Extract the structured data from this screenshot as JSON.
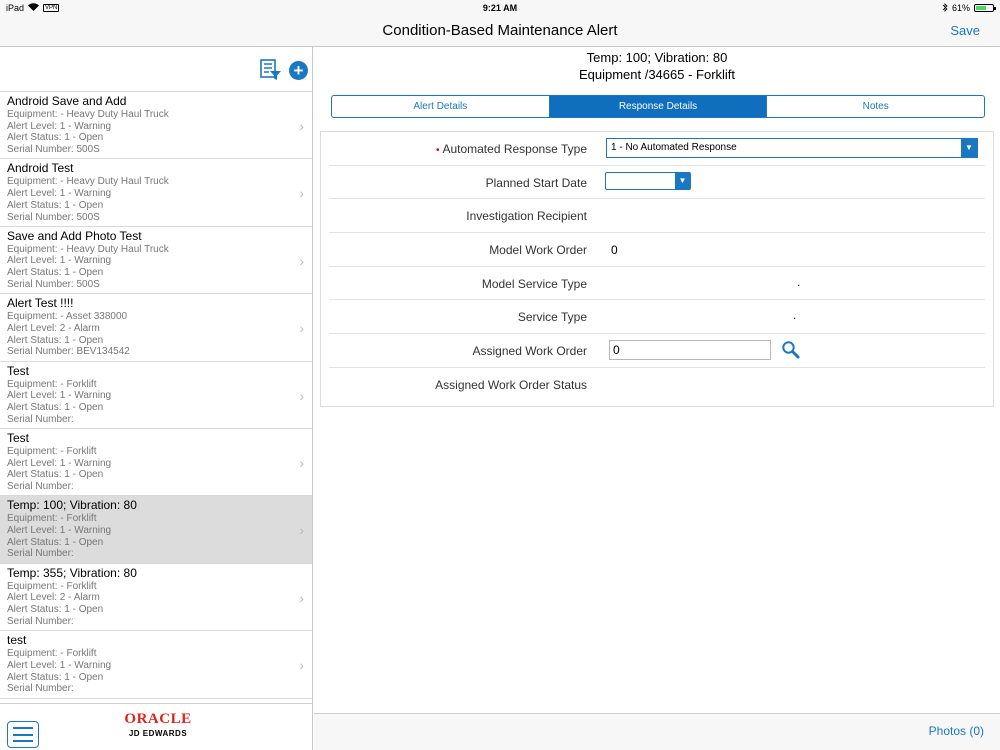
{
  "status_bar": {
    "device": "iPad",
    "vpn": "VPN",
    "time": "9:21 AM",
    "battery": "61%",
    "battery_level": 0.61
  },
  "navbar": {
    "title": "Condition-Based Maintenance Alert",
    "save_label": "Save"
  },
  "alerts": [
    {
      "title": "Android Save and Add",
      "equipment": "Equipment: - Heavy Duty Haul Truck",
      "level": "Alert Level: 1 - Warning",
      "status": "Alert Status: 1 - Open",
      "serial": "Serial Number: 500S"
    },
    {
      "title": "Android Test",
      "equipment": "Equipment: - Heavy Duty Haul Truck",
      "level": "Alert Level: 1 - Warning",
      "status": "Alert Status: 1 - Open",
      "serial": "Serial Number: 500S"
    },
    {
      "title": "Save and Add Photo Test",
      "equipment": "Equipment: - Heavy Duty Haul Truck",
      "level": "Alert Level: 1 - Warning",
      "status": "Alert Status: 1 - Open",
      "serial": "Serial Number: 500S"
    },
    {
      "title": "Alert Test !!!!",
      "equipment": "Equipment: - Asset 338000",
      "level": "Alert Level: 2 - Alarm",
      "status": "Alert Status: 1 - Open",
      "serial": "Serial Number: BEV134542"
    },
    {
      "title": "Test",
      "equipment": "Equipment: - Forklift",
      "level": "Alert Level: 1 - Warning",
      "status": "Alert Status: 1 - Open",
      "serial": "Serial Number:"
    },
    {
      "title": "Test",
      "equipment": "Equipment: - Forklift",
      "level": "Alert Level: 1 - Warning",
      "status": "Alert Status: 1 - Open",
      "serial": "Serial Number:"
    },
    {
      "title": "Temp: 100; Vibration: 80",
      "equipment": "Equipment: - Forklift",
      "level": "Alert Level: 1 - Warning",
      "status": "Alert Status: 1 - Open",
      "serial": "Serial Number:"
    },
    {
      "title": "Temp: 355; Vibration: 80",
      "equipment": "Equipment: - Forklift",
      "level": "Alert Level: 2 - Alarm",
      "status": "Alert Status: 1 - Open",
      "serial": "Serial Number:"
    },
    {
      "title": "test",
      "equipment": "Equipment: - Forklift",
      "level": "Alert Level: 1 - Warning",
      "status": "Alert Status: 1 - Open",
      "serial": "Serial Number:"
    }
  ],
  "selected_alert_index": 6,
  "logo": {
    "brand": "ORACLE",
    "product": "JD EDWARDS"
  },
  "detail": {
    "header_line1": "Temp: 100; Vibration: 80",
    "header_line2": "Equipment /34665 - Forklift",
    "tabs": [
      "Alert Details",
      "Response Details",
      "Notes"
    ],
    "active_tab": 1,
    "fields": {
      "automated_response_type": {
        "label": "Automated Response Type",
        "value": "1 - No Automated Response",
        "required_mark": "•"
      },
      "planned_start_date": {
        "label": "Planned Start Date",
        "value": ""
      },
      "investigation_recipient": {
        "label": "Investigation Recipient",
        "value": ""
      },
      "model_work_order": {
        "label": "Model Work Order",
        "value": "0"
      },
      "model_service_type": {
        "label": "Model Service Type",
        "value": "."
      },
      "service_type": {
        "label": "Service Type",
        "value": "."
      },
      "assigned_work_order": {
        "label": "Assigned Work Order",
        "value": "0"
      },
      "assigned_work_order_status": {
        "label": "Assigned Work Order Status",
        "value": ""
      }
    },
    "photos_label": "Photos (0)"
  },
  "colors": {
    "accent": "#1a78c2",
    "tab_active": "#0f6ebe",
    "selected_row": "#dcdcdc",
    "oracle_red": "#e2231a",
    "required": "#d0021b"
  },
  "icons": {
    "filter": "filter-list-icon",
    "add": "add-circle-icon",
    "menu": "hamburger-menu-icon",
    "search": "magnifier-search-icon",
    "chevron": "chevron-right-icon"
  }
}
